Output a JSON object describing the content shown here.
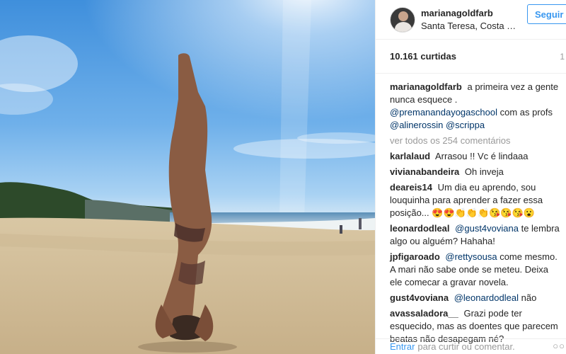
{
  "post": {
    "username": "marianagoldfarb",
    "location": "Santa Teresa, Costa Rica",
    "follow_label": "Seguir",
    "likes": "10.161 curtidas",
    "time": "1",
    "caption": {
      "user": "marianagoldfarb",
      "text": "a primeira vez a gente nunca esquece .",
      "mention1": "@premanandayogaschool",
      "mid_text": "com as profs",
      "mention2": "@alinerossin",
      "mention3": "@scrippa"
    },
    "view_all": "ver todos os 254 comentários",
    "comments": [
      {
        "user": "karlalaud",
        "text": "Arrasou !! Vc é lindaaa"
      },
      {
        "user": "vivianabandeira",
        "text": "Oh inveja"
      },
      {
        "user": "deareis14",
        "text": "Um dia eu aprendo, sou louquinha para aprender a fazer essa posição... 😍😍👏👏👏😘😘😘😮"
      },
      {
        "user": "leonardodleal",
        "mention": "@gust4voviana",
        "text": "te lembra algo ou alguém? Hahaha!"
      },
      {
        "user": "jpfigaroado",
        "mention": "@rettysousa",
        "text": "come mesmo. A mari não sabe onde se meteu. Deixa ele comecar a gravar novela."
      },
      {
        "user": "gust4voviana",
        "mention": "@leonardodleal",
        "text": "não"
      },
      {
        "user": "avassaladora__",
        "text": "Grazi pode ter esquecido, mas as doentes que parecem beatas não desapegam né?"
      }
    ],
    "footer": {
      "login_label": "Entrar",
      "rest": "para curtir ou comentar.",
      "more": "○○"
    }
  },
  "colors": {
    "link_blue": "#3897f0",
    "mention_blue": "#003569",
    "muted": "#999999"
  }
}
